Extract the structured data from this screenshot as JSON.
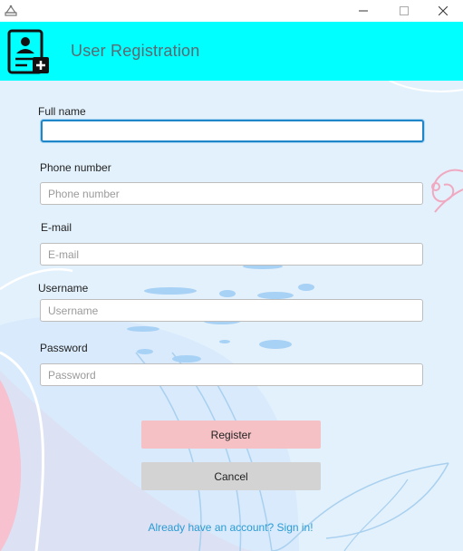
{
  "window": {
    "minimize_icon": "minimize-icon",
    "maximize_icon": "maximize-icon",
    "close_icon": "close-icon"
  },
  "header": {
    "title": "User Registration",
    "icon": "add-user-icon",
    "background_color": "#00ffff"
  },
  "form": {
    "full_name": {
      "label": "Full name",
      "value": "",
      "placeholder": ""
    },
    "phone": {
      "label": "Phone number",
      "value": "",
      "placeholder": "Phone number"
    },
    "email": {
      "label": "E-mail",
      "value": "",
      "placeholder": "E-mail"
    },
    "username": {
      "label": "Username",
      "value": "",
      "placeholder": "Username"
    },
    "password": {
      "label": "Password",
      "value": "",
      "placeholder": "Password"
    }
  },
  "buttons": {
    "register_label": "Register",
    "cancel_label": "Cancel",
    "register_color": "#f5c1c5",
    "cancel_color": "#d3d3d3"
  },
  "footer": {
    "signin_link": "Already have an account? Sign in!",
    "link_color": "#2a9bd4"
  }
}
